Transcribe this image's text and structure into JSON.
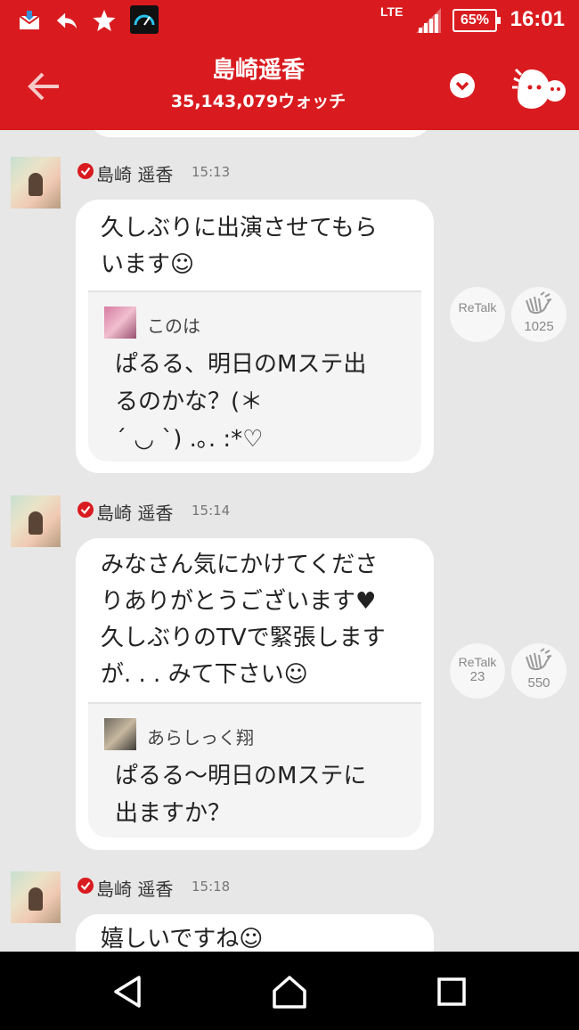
{
  "status_bar": {
    "network": "LTE",
    "battery": "65%",
    "time": "16:01"
  },
  "header": {
    "title": "島崎遥香",
    "subtitle": "35,143,079ウォッチ"
  },
  "messages": [
    {
      "author": "島崎 遥香",
      "time": "15:13",
      "text_lines": [
        "久しぶりに出演させてもら",
        "います☺"
      ],
      "quote": {
        "author": "このは",
        "text_lines": [
          "ぱるる、明日のMステ出",
          "るのかな？(＊",
          "´ ◡ `) .｡. :*♡"
        ]
      },
      "retalk": {
        "label": "ReTalk",
        "count": ""
      },
      "claps": {
        "count": "1025"
      }
    },
    {
      "author": "島崎 遥香",
      "time": "15:14",
      "text_lines": [
        "みなさん気にかけてくださ",
        "りありがとうございます♥",
        "久しぶりのTVで緊張します",
        "が. . . みて下さい☺"
      ],
      "quote": {
        "author": "あらしっく翔",
        "text_lines": [
          "ぱるる〜明日のMステに",
          "出ますか？"
        ]
      },
      "retalk": {
        "label": "ReTalk",
        "count": "23"
      },
      "claps": {
        "count": "550"
      }
    },
    {
      "author": "島崎 遥香",
      "time": "15:18",
      "text_lines": [
        "嬉しいですね☺"
      ]
    }
  ],
  "colors": {
    "brand_red": "#d91b1f",
    "background": "#e7e7e7"
  },
  "icons": [
    "mail-icon",
    "reply-icon",
    "star-icon",
    "speedometer-icon",
    "signal-icon",
    "battery-icon",
    "back-arrow-icon",
    "chevron-down-icon",
    "mascot-icon",
    "verified-check-icon",
    "clap-icon",
    "nav-back-icon",
    "nav-home-icon",
    "nav-recents-icon"
  ]
}
